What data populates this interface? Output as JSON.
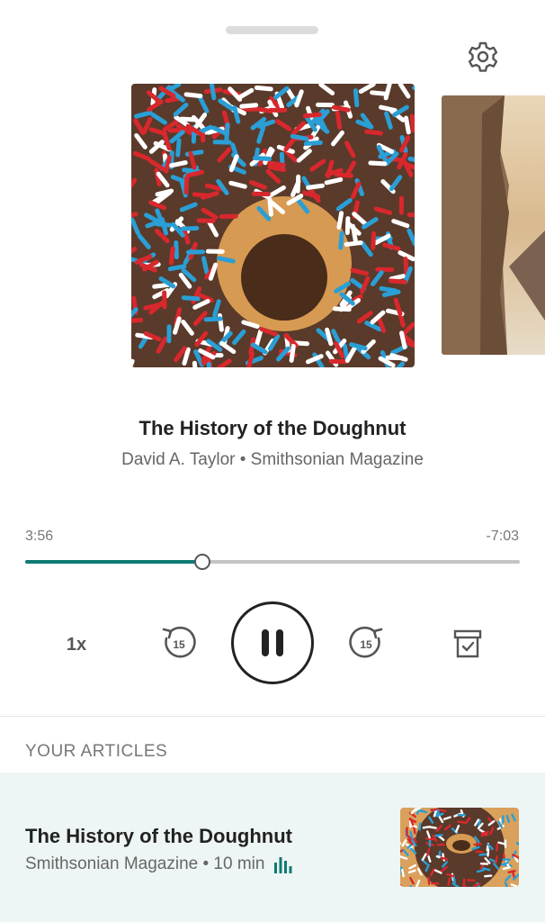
{
  "player": {
    "title": "The History of the Doughnut",
    "subtitle": "David A. Taylor • Smithsonian Magazine",
    "elapsed": "3:56",
    "remaining": "-7:03",
    "progress_fraction": 0.358,
    "speed": "1x",
    "rewind_seconds": "15",
    "forward_seconds": "15",
    "state": "playing"
  },
  "icons": {
    "settings": "gear-icon",
    "rewind": "rewind-15-icon",
    "pause": "pause-icon",
    "forward": "forward-15-icon",
    "archive": "archive-icon",
    "playing": "equalizer-icon"
  },
  "section": {
    "title": "YOUR ARTICLES"
  },
  "articles": [
    {
      "title": "The History of the Doughnut",
      "meta": "Smithsonian Magazine • 10 min"
    }
  ],
  "colors": {
    "accent": "#0f7a73",
    "track": "#c4c4c4",
    "row_bg": "#eef5f5"
  }
}
